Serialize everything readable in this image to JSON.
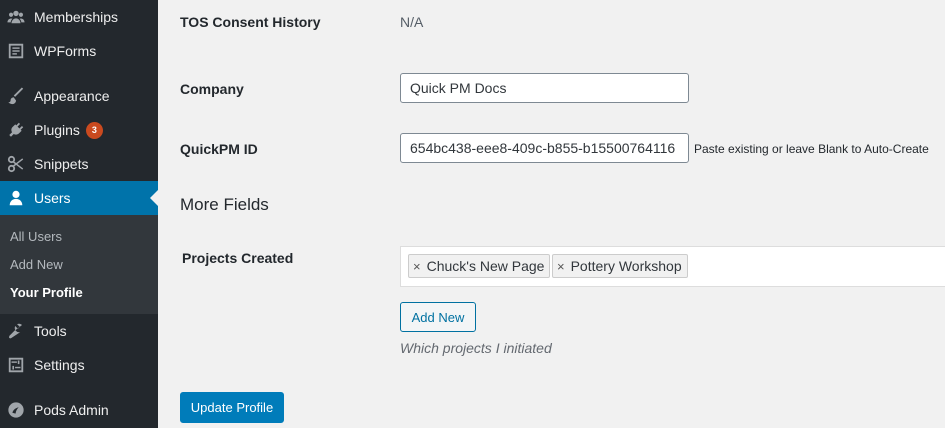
{
  "sidebar": {
    "items": [
      {
        "label": "Memberships",
        "icon": "groups-icon"
      },
      {
        "label": "WPForms",
        "icon": "wpforms-icon"
      },
      {
        "label": "Appearance",
        "icon": "paintbrush-icon"
      },
      {
        "label": "Plugins",
        "icon": "plugin-icon",
        "badge": "3"
      },
      {
        "label": "Snippets",
        "icon": "scissors-icon"
      },
      {
        "label": "Users",
        "icon": "user-icon"
      },
      {
        "label": "Tools",
        "icon": "wrench-icon"
      },
      {
        "label": "Settings",
        "icon": "settings-icon"
      },
      {
        "label": "Pods Admin",
        "icon": "pods-icon"
      }
    ],
    "users_submenu": [
      "All Users",
      "Add New",
      "Your Profile"
    ],
    "current_color": "#0073aa"
  },
  "profile": {
    "tos_label": "TOS Consent History",
    "tos_value": "N/A",
    "company_label": "Company",
    "company_value": "Quick PM Docs",
    "quickpm_label": "QuickPM ID",
    "quickpm_value": "654bc438-eee8-409c-b855-b15500764116",
    "quickpm_desc": "Paste existing or leave Blank to Auto-Create"
  },
  "more_fields": {
    "heading": "More Fields",
    "projects_label": "Projects Created",
    "tags": [
      "Chuck's New Page",
      "Pottery Workshop"
    ],
    "tag_remove": "×",
    "add_new_label": "Add New",
    "projects_desc": "Which projects I initiated"
  },
  "update_button": "Update Profile"
}
